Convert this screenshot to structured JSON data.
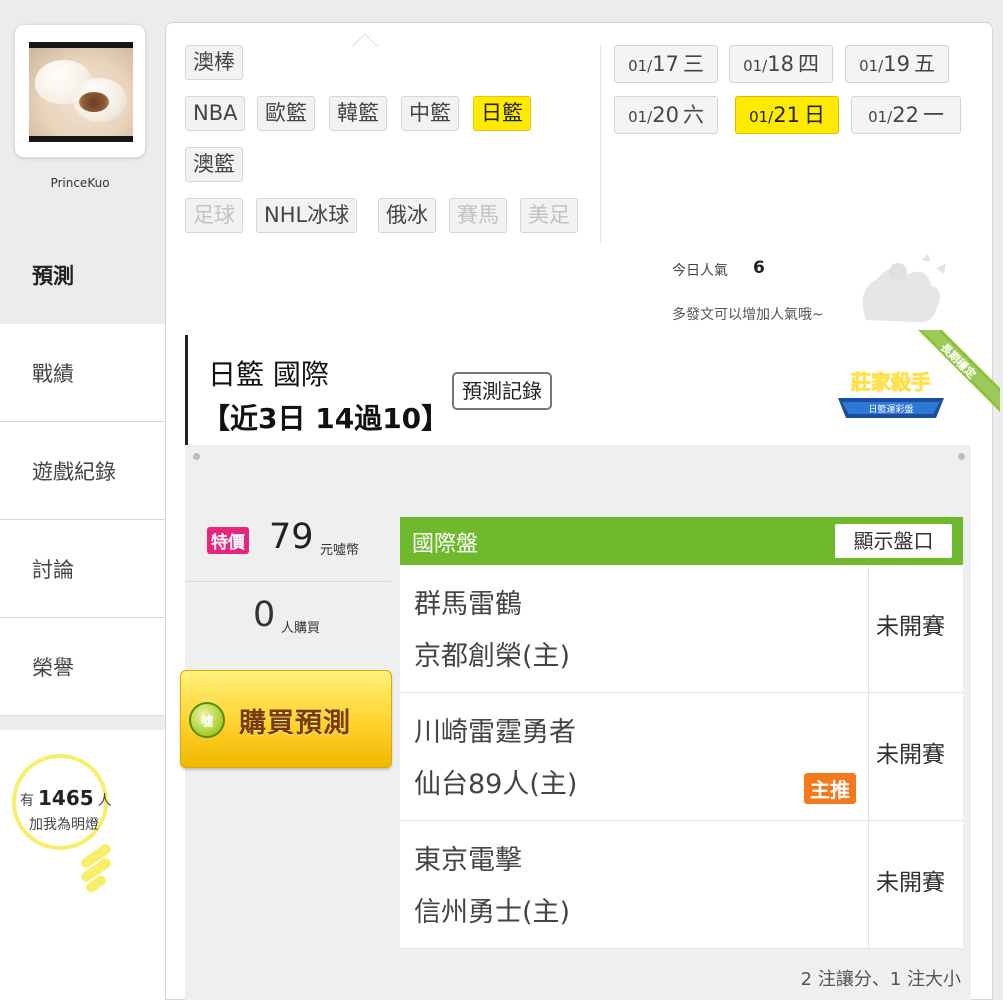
{
  "user": {
    "name": "PrinceKuo"
  },
  "nav": [
    {
      "label": "預測",
      "active": true
    },
    {
      "label": "戰績",
      "active": false
    },
    {
      "label": "遊戲紀錄",
      "active": false
    },
    {
      "label": "討論",
      "active": false
    },
    {
      "label": "榮譽",
      "active": false
    }
  ],
  "fans": {
    "prefix": "有",
    "count": "1465",
    "suffix": "人",
    "line2": "加我為明燈"
  },
  "sports": [
    {
      "label": "澳棒",
      "state": "normal"
    },
    {
      "label": "NBA",
      "state": "normal"
    },
    {
      "label": "歐籃",
      "state": "normal"
    },
    {
      "label": "韓籃",
      "state": "normal"
    },
    {
      "label": "中籃",
      "state": "normal"
    },
    {
      "label": "日籃",
      "state": "active"
    },
    {
      "label": "澳籃",
      "state": "normal"
    },
    {
      "label": "足球",
      "state": "disabled"
    },
    {
      "label": "NHL冰球",
      "state": "normal"
    },
    {
      "label": "俄冰",
      "state": "normal"
    },
    {
      "label": "賽馬",
      "state": "disabled"
    },
    {
      "label": "美足",
      "state": "disabled"
    }
  ],
  "dates": [
    {
      "month": "01/",
      "day": "17",
      "weekday": "三",
      "active": false
    },
    {
      "month": "01/",
      "day": "18",
      "weekday": "四",
      "active": false
    },
    {
      "month": "01/",
      "day": "19",
      "weekday": "五",
      "active": false
    },
    {
      "month": "01/",
      "day": "20",
      "weekday": "六",
      "active": false
    },
    {
      "month": "01/",
      "day": "21",
      "weekday": "日",
      "active": true
    },
    {
      "month": "01/",
      "day": "22",
      "weekday": "一",
      "active": false
    }
  ],
  "popularity": {
    "label": "今日人氣",
    "value": "6",
    "hint": "多發文可以增加人氣哦~"
  },
  "prediction": {
    "title": "日籃 國際",
    "record": "【近3日 14過10】",
    "record_button": "預測記錄",
    "badge_title": "莊家殺手",
    "badge_sub": "日籃運彩盤",
    "ribbon": "長期穩定"
  },
  "purchase": {
    "special_tag": "特價",
    "price": "79",
    "price_unit": "元噓幣",
    "buyers": "0",
    "buyers_unit": "人購買",
    "button_icon": "噓",
    "button_label": "購買預測"
  },
  "matches": {
    "header": "國際盤",
    "show_odds": "顯示盤口",
    "rows": [
      {
        "away": "群馬雷鶴",
        "home": "京都創榮(主)",
        "status": "未開賽",
        "tag": ""
      },
      {
        "away": "川崎雷霆勇者",
        "home": "仙台89人(主)",
        "status": "未開賽",
        "tag": "主推"
      },
      {
        "away": "東京電擊",
        "home": "信州勇士(主)",
        "status": "未開賽",
        "tag": ""
      }
    ],
    "summary": "2 注讓分、1 注大小"
  },
  "colors": {
    "accent_yellow": "#ffeb00",
    "header_green": "#6fba2c",
    "special_pink": "#e8257e",
    "recommend_orange": "#f4781c"
  }
}
